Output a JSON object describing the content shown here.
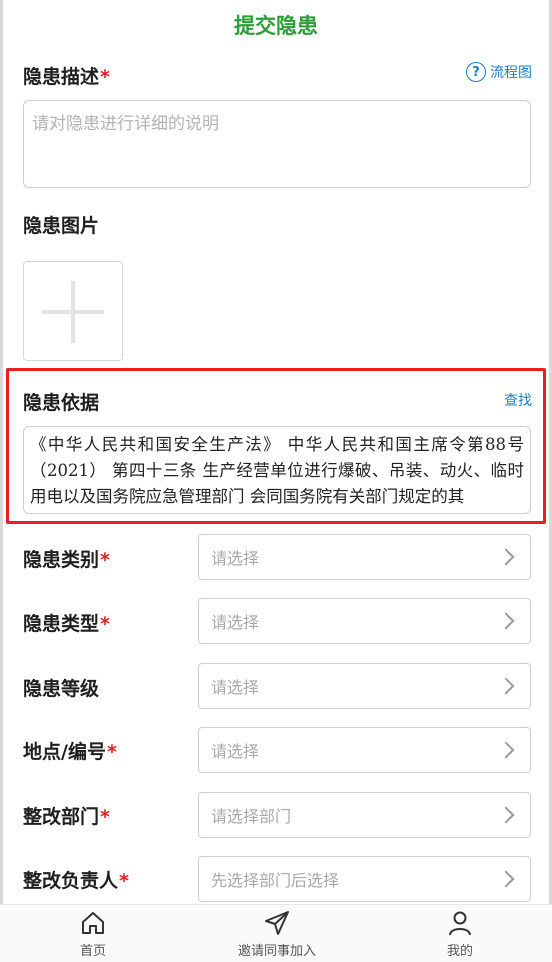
{
  "header": {
    "title": "提交隐患"
  },
  "description": {
    "label": "隐患描述",
    "required_mark": "*",
    "help_icon": "question-circle-icon",
    "help_text": "流程图",
    "placeholder": "请对隐患进行详细的说明"
  },
  "images": {
    "label": "隐患图片",
    "add_icon": "plus-icon"
  },
  "basis": {
    "label": "隐患依据",
    "find_text": "查找",
    "highlight_color": "#e62020",
    "content": "《中华人民共和国安全生产法》 中华人民共和国主席令第88号（2021） 第四十三条 生产经营单位进行爆破、吊装、动火、临时用电以及国务院应急管理部门 会同国务院有关部门规定的其"
  },
  "fields": [
    {
      "label": "隐患类别",
      "required": "*",
      "placeholder": "请选择"
    },
    {
      "label": "隐患类型",
      "required": "*",
      "placeholder": "请选择"
    },
    {
      "label": "隐患等级",
      "required": "",
      "placeholder": "请选择"
    },
    {
      "label": "地点/编号",
      "required": "*",
      "placeholder": "请选择"
    },
    {
      "label": "整改部门",
      "required": "*",
      "placeholder": "请选择部门"
    },
    {
      "label": "整改负责人",
      "required": "*",
      "placeholder": "先选择部门后选择"
    }
  ],
  "tabbar": [
    {
      "label": "首页",
      "icon": "home-icon"
    },
    {
      "label": "邀请同事加入",
      "icon": "send-icon"
    },
    {
      "label": "我的",
      "icon": "user-icon"
    }
  ],
  "colors": {
    "accent_green": "#2d9d3a",
    "link_blue": "#1a7fc9",
    "required_red": "#e02020"
  }
}
